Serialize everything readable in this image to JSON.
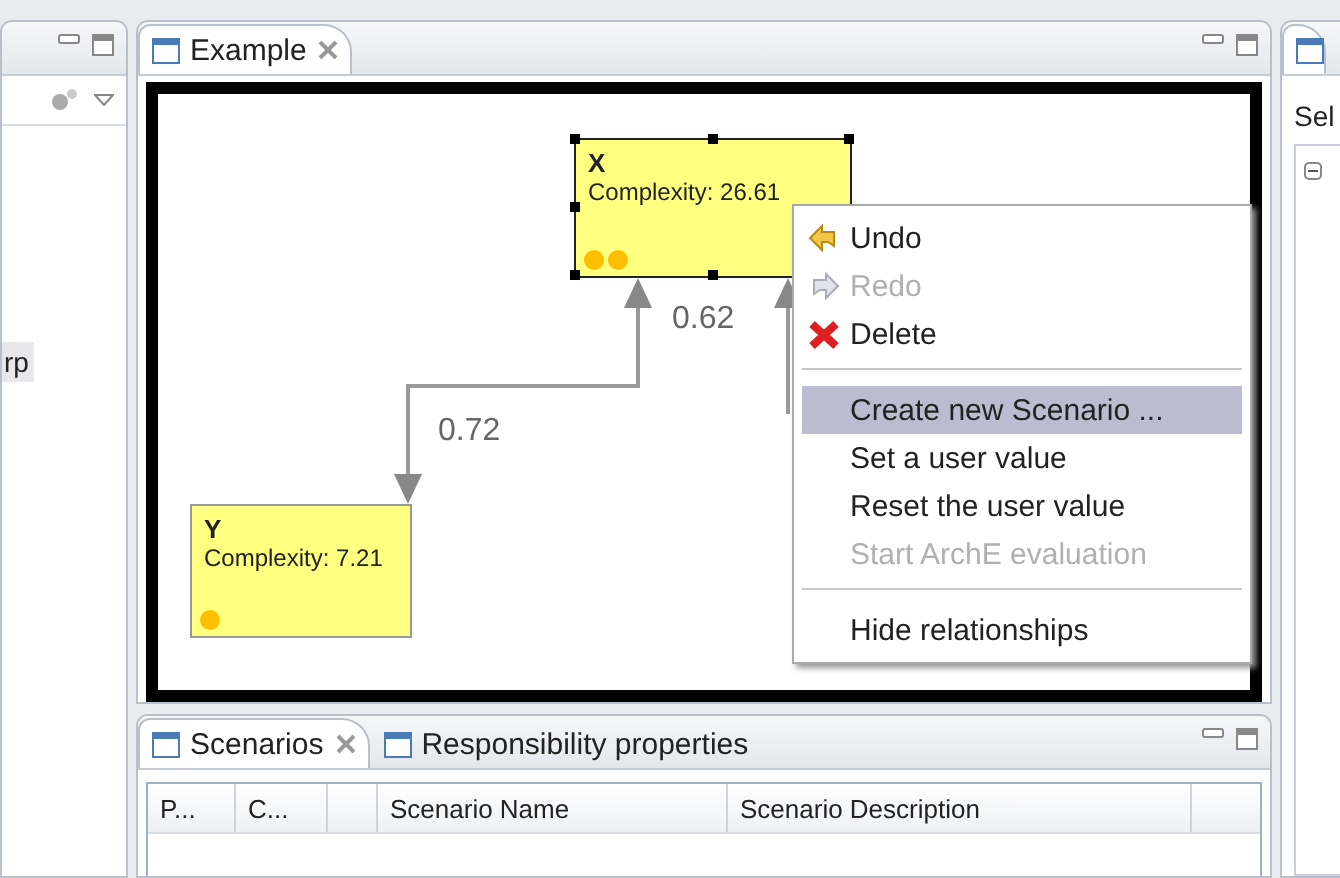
{
  "left_panel": {
    "item": "rp"
  },
  "editor": {
    "tab": {
      "title": "Example",
      "selected": true
    },
    "nodes": [
      {
        "name": "X",
        "detail": "Complexity: 26.61",
        "selected": true,
        "indicators": [
          {
            "kind": "dot"
          },
          {
            "kind": "dot"
          }
        ]
      },
      {
        "name": "Y",
        "detail": "Complexity: 7.21",
        "selected": false,
        "indicators": [
          {
            "kind": "dot"
          }
        ]
      }
    ],
    "edges": [
      {
        "label": "0.72"
      },
      {
        "label": "0.62"
      }
    ]
  },
  "context_menu": [
    {
      "kind": "item",
      "label": "Undo",
      "disabled": false,
      "selected": false
    },
    {
      "kind": "item",
      "label": "Redo",
      "disabled": true,
      "selected": false
    },
    {
      "kind": "item",
      "label": "Delete",
      "disabled": false,
      "selected": false
    },
    {
      "kind": "separator"
    },
    {
      "kind": "item",
      "label": "Create new Scenario ...",
      "disabled": false,
      "selected": true
    },
    {
      "kind": "item",
      "label": "Set a user value",
      "disabled": false,
      "selected": false
    },
    {
      "kind": "item",
      "label": "Reset the user value",
      "disabled": false,
      "selected": false
    },
    {
      "kind": "item",
      "label": "Start ArchE evaluation",
      "disabled": true,
      "selected": false
    },
    {
      "kind": "separator"
    },
    {
      "kind": "item",
      "label": "Hide relationships",
      "disabled": false,
      "selected": false
    }
  ],
  "bottom_panel": {
    "tabs": [
      {
        "label": "Scenarios",
        "selected": true
      },
      {
        "label": "Responsibility properties",
        "selected": false
      }
    ],
    "columns": [
      {
        "label": "P..."
      },
      {
        "label": "C..."
      },
      {},
      {
        "label": "Scenario Name"
      },
      {
        "label": "Scenario Description"
      }
    ]
  },
  "right_panel": {
    "label": "Sel"
  }
}
